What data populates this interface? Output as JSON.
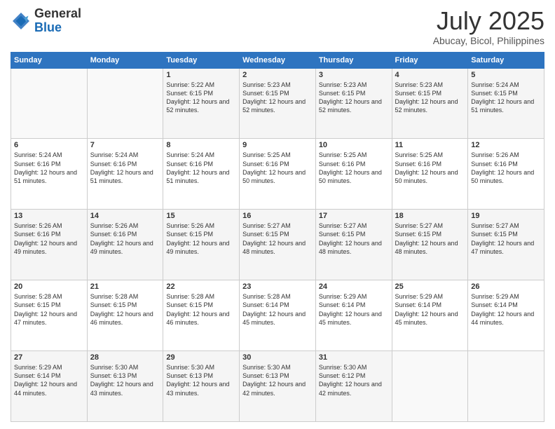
{
  "header": {
    "logo": {
      "line1": "General",
      "line2": "Blue"
    },
    "title": "July 2025",
    "location": "Abucay, Bicol, Philippines"
  },
  "weekdays": [
    "Sunday",
    "Monday",
    "Tuesday",
    "Wednesday",
    "Thursday",
    "Friday",
    "Saturday"
  ],
  "weeks": [
    [
      {
        "day": "",
        "info": ""
      },
      {
        "day": "",
        "info": ""
      },
      {
        "day": "1",
        "info": "Sunrise: 5:22 AM\nSunset: 6:15 PM\nDaylight: 12 hours and 52 minutes."
      },
      {
        "day": "2",
        "info": "Sunrise: 5:23 AM\nSunset: 6:15 PM\nDaylight: 12 hours and 52 minutes."
      },
      {
        "day": "3",
        "info": "Sunrise: 5:23 AM\nSunset: 6:15 PM\nDaylight: 12 hours and 52 minutes."
      },
      {
        "day": "4",
        "info": "Sunrise: 5:23 AM\nSunset: 6:15 PM\nDaylight: 12 hours and 52 minutes."
      },
      {
        "day": "5",
        "info": "Sunrise: 5:24 AM\nSunset: 6:15 PM\nDaylight: 12 hours and 51 minutes."
      }
    ],
    [
      {
        "day": "6",
        "info": "Sunrise: 5:24 AM\nSunset: 6:16 PM\nDaylight: 12 hours and 51 minutes."
      },
      {
        "day": "7",
        "info": "Sunrise: 5:24 AM\nSunset: 6:16 PM\nDaylight: 12 hours and 51 minutes."
      },
      {
        "day": "8",
        "info": "Sunrise: 5:24 AM\nSunset: 6:16 PM\nDaylight: 12 hours and 51 minutes."
      },
      {
        "day": "9",
        "info": "Sunrise: 5:25 AM\nSunset: 6:16 PM\nDaylight: 12 hours and 50 minutes."
      },
      {
        "day": "10",
        "info": "Sunrise: 5:25 AM\nSunset: 6:16 PM\nDaylight: 12 hours and 50 minutes."
      },
      {
        "day": "11",
        "info": "Sunrise: 5:25 AM\nSunset: 6:16 PM\nDaylight: 12 hours and 50 minutes."
      },
      {
        "day": "12",
        "info": "Sunrise: 5:26 AM\nSunset: 6:16 PM\nDaylight: 12 hours and 50 minutes."
      }
    ],
    [
      {
        "day": "13",
        "info": "Sunrise: 5:26 AM\nSunset: 6:16 PM\nDaylight: 12 hours and 49 minutes."
      },
      {
        "day": "14",
        "info": "Sunrise: 5:26 AM\nSunset: 6:16 PM\nDaylight: 12 hours and 49 minutes."
      },
      {
        "day": "15",
        "info": "Sunrise: 5:26 AM\nSunset: 6:15 PM\nDaylight: 12 hours and 49 minutes."
      },
      {
        "day": "16",
        "info": "Sunrise: 5:27 AM\nSunset: 6:15 PM\nDaylight: 12 hours and 48 minutes."
      },
      {
        "day": "17",
        "info": "Sunrise: 5:27 AM\nSunset: 6:15 PM\nDaylight: 12 hours and 48 minutes."
      },
      {
        "day": "18",
        "info": "Sunrise: 5:27 AM\nSunset: 6:15 PM\nDaylight: 12 hours and 48 minutes."
      },
      {
        "day": "19",
        "info": "Sunrise: 5:27 AM\nSunset: 6:15 PM\nDaylight: 12 hours and 47 minutes."
      }
    ],
    [
      {
        "day": "20",
        "info": "Sunrise: 5:28 AM\nSunset: 6:15 PM\nDaylight: 12 hours and 47 minutes."
      },
      {
        "day": "21",
        "info": "Sunrise: 5:28 AM\nSunset: 6:15 PM\nDaylight: 12 hours and 46 minutes."
      },
      {
        "day": "22",
        "info": "Sunrise: 5:28 AM\nSunset: 6:15 PM\nDaylight: 12 hours and 46 minutes."
      },
      {
        "day": "23",
        "info": "Sunrise: 5:28 AM\nSunset: 6:14 PM\nDaylight: 12 hours and 45 minutes."
      },
      {
        "day": "24",
        "info": "Sunrise: 5:29 AM\nSunset: 6:14 PM\nDaylight: 12 hours and 45 minutes."
      },
      {
        "day": "25",
        "info": "Sunrise: 5:29 AM\nSunset: 6:14 PM\nDaylight: 12 hours and 45 minutes."
      },
      {
        "day": "26",
        "info": "Sunrise: 5:29 AM\nSunset: 6:14 PM\nDaylight: 12 hours and 44 minutes."
      }
    ],
    [
      {
        "day": "27",
        "info": "Sunrise: 5:29 AM\nSunset: 6:14 PM\nDaylight: 12 hours and 44 minutes."
      },
      {
        "day": "28",
        "info": "Sunrise: 5:30 AM\nSunset: 6:13 PM\nDaylight: 12 hours and 43 minutes."
      },
      {
        "day": "29",
        "info": "Sunrise: 5:30 AM\nSunset: 6:13 PM\nDaylight: 12 hours and 43 minutes."
      },
      {
        "day": "30",
        "info": "Sunrise: 5:30 AM\nSunset: 6:13 PM\nDaylight: 12 hours and 42 minutes."
      },
      {
        "day": "31",
        "info": "Sunrise: 5:30 AM\nSunset: 6:12 PM\nDaylight: 12 hours and 42 minutes."
      },
      {
        "day": "",
        "info": ""
      },
      {
        "day": "",
        "info": ""
      }
    ]
  ]
}
